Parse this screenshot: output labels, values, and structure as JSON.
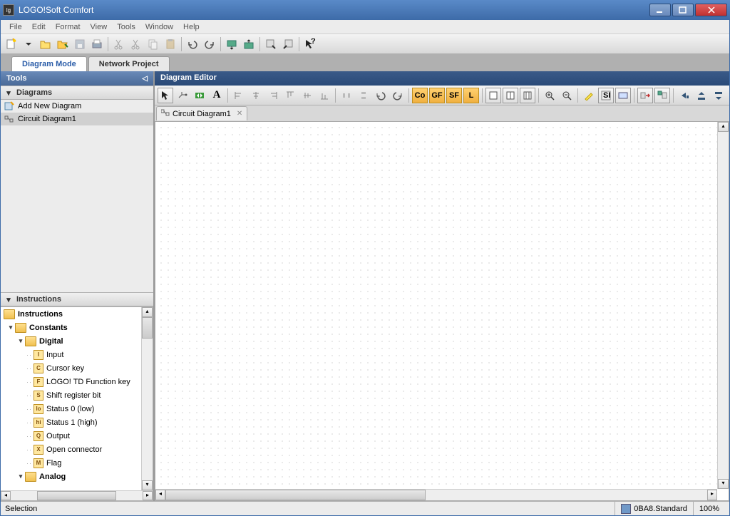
{
  "window": {
    "title": "LOGO!Soft Comfort"
  },
  "menu": {
    "file": "File",
    "edit": "Edit",
    "format": "Format",
    "view": "View",
    "tools": "Tools",
    "window": "Window",
    "help": "Help"
  },
  "mode_tabs": {
    "diagram": "Diagram Mode",
    "network": "Network Project"
  },
  "tools_panel": {
    "title": "Tools"
  },
  "diagrams": {
    "header": "Diagrams",
    "add_new": "Add New Diagram",
    "items": [
      {
        "label": "Circuit Diagram1"
      }
    ]
  },
  "instructions_panel": {
    "header": "Instructions"
  },
  "tree": {
    "root": "Instructions",
    "constants": "Constants",
    "digital": "Digital",
    "analog": "Analog",
    "digital_nodes": [
      {
        "sym": "I",
        "label": "Input"
      },
      {
        "sym": "C",
        "label": "Cursor key"
      },
      {
        "sym": "F",
        "label": "LOGO! TD Function key"
      },
      {
        "sym": "S",
        "label": "Shift register bit"
      },
      {
        "sym": "lo",
        "label": "Status 0 (low)"
      },
      {
        "sym": "hi",
        "label": "Status 1 (high)"
      },
      {
        "sym": "Q",
        "label": "Output"
      },
      {
        "sym": "X",
        "label": "Open connector"
      },
      {
        "sym": "M",
        "label": "Flag"
      }
    ]
  },
  "editor": {
    "title": "Diagram Editor",
    "tab": "Circuit Diagram1"
  },
  "editor_btns": {
    "co": "Co",
    "gf": "GF",
    "sf": "SF",
    "l": "L",
    "a": "A"
  },
  "status": {
    "mode": "Selection",
    "device": "0BA8.Standard",
    "zoom": "100%"
  }
}
